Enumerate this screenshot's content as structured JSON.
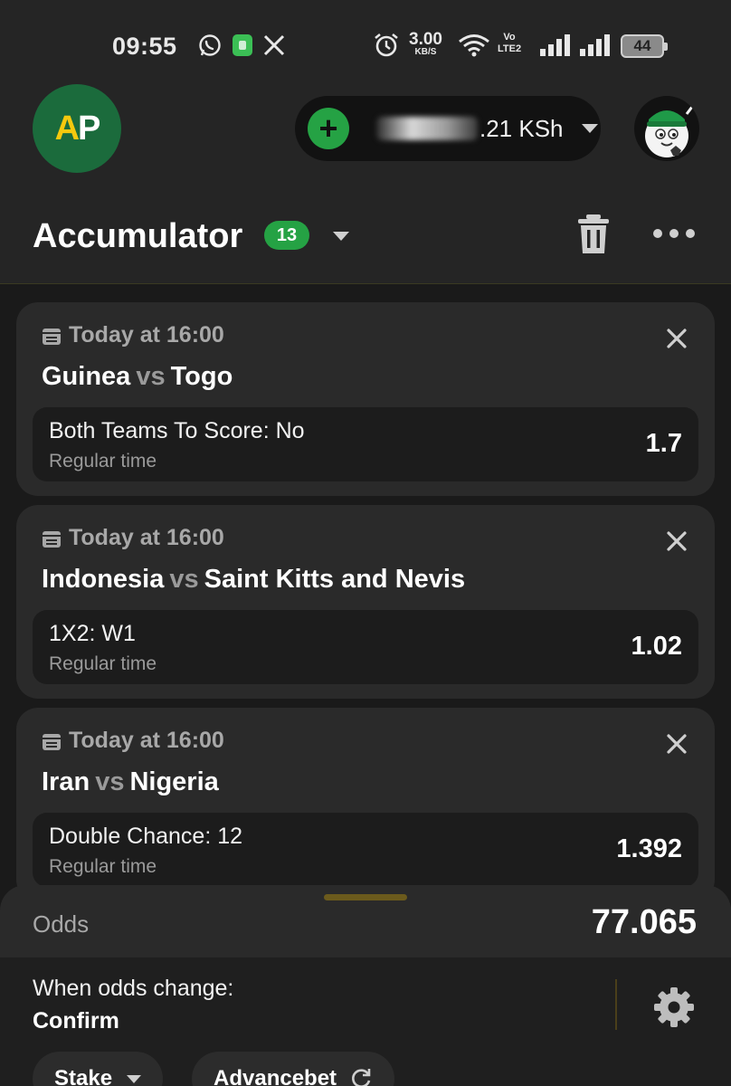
{
  "status_bar": {
    "time": "09:55",
    "net_speed_value": "3.00",
    "net_speed_unit": "KB/S",
    "volte_top": "Vo",
    "volte_bottom": "LTE2",
    "battery": "44",
    "icons": [
      "whatsapp-icon",
      "app-icon",
      "x-icon",
      "alarm-icon",
      "wifi-icon",
      "signal-icon",
      "signal-icon"
    ]
  },
  "header": {
    "logo_left": "A",
    "logo_right": "P",
    "balance_currency": "KSh",
    "balance_suffix": "5.21 KSh",
    "balance_visible_end": ".21 KSh",
    "title": "Accumulator",
    "count": "13",
    "colors": {
      "accent_green": "#25a244",
      "logo_bg": "#1b6b3c",
      "logo_yellow": "#f6c90e"
    }
  },
  "bets": [
    {
      "date": "Today at 16:00",
      "home": "Guinea",
      "vs": "vs",
      "away": "Togo",
      "market": "Both Teams To Score: No",
      "period": "Regular time",
      "odd": "1.7"
    },
    {
      "date": "Today at 16:00",
      "home": "Indonesia",
      "vs": "vs",
      "away": "Saint Kitts and Nevis",
      "market": "1X2: W1",
      "period": "Regular time",
      "odd": "1.02"
    },
    {
      "date": "Today at 16:00",
      "home": "Iran",
      "vs": "vs",
      "away": "Nigeria",
      "market": "Double Chance: 12",
      "period": "Regular time",
      "odd": "1.392"
    }
  ],
  "slip": {
    "odds_label": "Odds",
    "odds_total": "77.065",
    "when_odds_change_label": "When odds change:",
    "when_odds_change_value": "Confirm",
    "stake_chip": "Stake",
    "advancebet_chip": "Advancebet"
  }
}
